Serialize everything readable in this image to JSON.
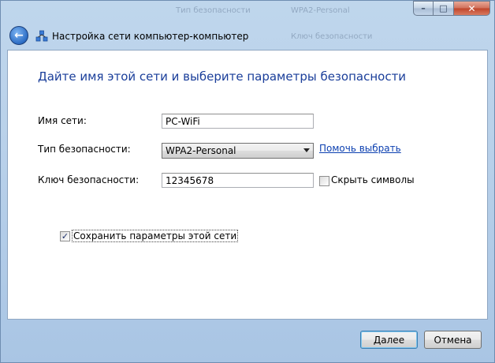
{
  "window": {
    "title": "Настройка сети компьютер-компьютер",
    "controls": {
      "minimize": "–",
      "maximize": "□",
      "close": "✕"
    },
    "background_faint_text": [
      "Тип безопасности",
      "WPA2-Personal",
      "Ключ безопасности"
    ]
  },
  "nav": {
    "back_icon": "back-arrow-icon",
    "network_icon": "network-icon",
    "back_glyph": "←"
  },
  "heading": "Дайте имя этой сети и выберите параметры безопасности",
  "form": {
    "network_name_label": "Имя сети:",
    "network_name_value": "PC-WiFi",
    "security_type_label": "Тип безопасности:",
    "security_type_value": "WPA2-Personal",
    "help_link": "Помочь выбрать",
    "security_key_label": "Ключ безопасности:",
    "security_key_value": "12345678",
    "hide_chars_label": "Скрыть символы",
    "hide_chars_checked": false,
    "save_settings_label": "Сохранить параметры этой сети",
    "save_settings_checked": true,
    "checkmark_glyph": "✓"
  },
  "buttons": {
    "next": "Далее",
    "cancel": "Отмена"
  },
  "colors": {
    "heading": "#1a3e9a",
    "link": "#0b3fb0",
    "frame": "#b9d1ea"
  }
}
